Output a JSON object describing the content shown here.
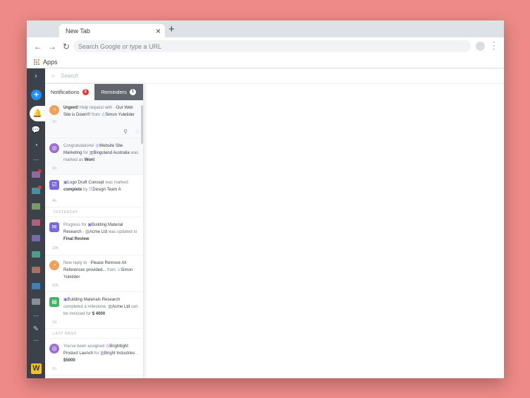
{
  "browser": {
    "tab_title": "New Tab",
    "tab_close": "×",
    "new_tab": "+",
    "omnibox_placeholder": "Search Google or type a URL",
    "bookmarks_apps": "Apps",
    "icons": [
      "back-arrow-icon",
      "forward-arrow-icon",
      "reload-icon",
      "profile-icon",
      "more-menu-icon",
      "apps-grid-icon"
    ]
  },
  "app": {
    "search_placeholder": "Search",
    "tabs": {
      "notifications": "Notifications",
      "notifications_count": "2",
      "reminders": "Reminders",
      "reminders_count": "1"
    },
    "sections": {
      "yesterday": "YESTERDAY",
      "last_week": "LAST WEEK"
    },
    "notifications": [
      {
        "urgent": "Urgent!",
        "t1": " Help request with ",
        "task": "Our Web Site is Down!!!",
        "t2": " from ",
        "user": "Simon Yuletider",
        "time": "1h"
      },
      {
        "t1": "Congratulations! ",
        "task": "Website Site Marketing",
        "t2": " for ",
        "org": "Bingoland Australia",
        "t3": " was marked as ",
        "status": "Won!",
        "time": "1h"
      },
      {
        "task": "Logo Draft Concept",
        "t1": " was marked ",
        "status": "complete",
        "t2": " by ",
        "team": "Design Team A",
        "time": "4h"
      },
      {
        "t1": "Progress for ",
        "task": "Building Material Research",
        "t2": " - ",
        "org": "Acme Ltd",
        "t3": " was updated to ",
        "status": "Final Review",
        "time": "18h"
      },
      {
        "t1": "New reply to ",
        "task": "Please Remove All References provided...",
        "t2": " from ",
        "user": "Simon Yuletider",
        "time": "20h"
      },
      {
        "task": "Building Materials Research",
        "t1": " completed a milestone. ",
        "org": "Acme Ltd",
        "t2": " can be invoiced for ",
        "amount": "$ 4000",
        "time": "1d"
      },
      {
        "t1": "You've been assigned ",
        "task": "Brightlight Product Launch",
        "t2": " for ",
        "org": "Bright Industries",
        "t3": " . ",
        "amount": "$5000",
        "time": "1h"
      }
    ],
    "rail_logo": "W"
  },
  "colors": {
    "background": "#ee8a87",
    "rail": "#3d4149",
    "accent_blue": "#1e90ff",
    "badge_red": "#e53935",
    "logo_yellow": "#f2c12e",
    "folders": [
      "#8e6a9e",
      "#4a90a4",
      "#7a9a6a",
      "#b0607a",
      "#7a6aa8",
      "#4f9c8f",
      "#a7715f",
      "#3f7fb8"
    ]
  }
}
